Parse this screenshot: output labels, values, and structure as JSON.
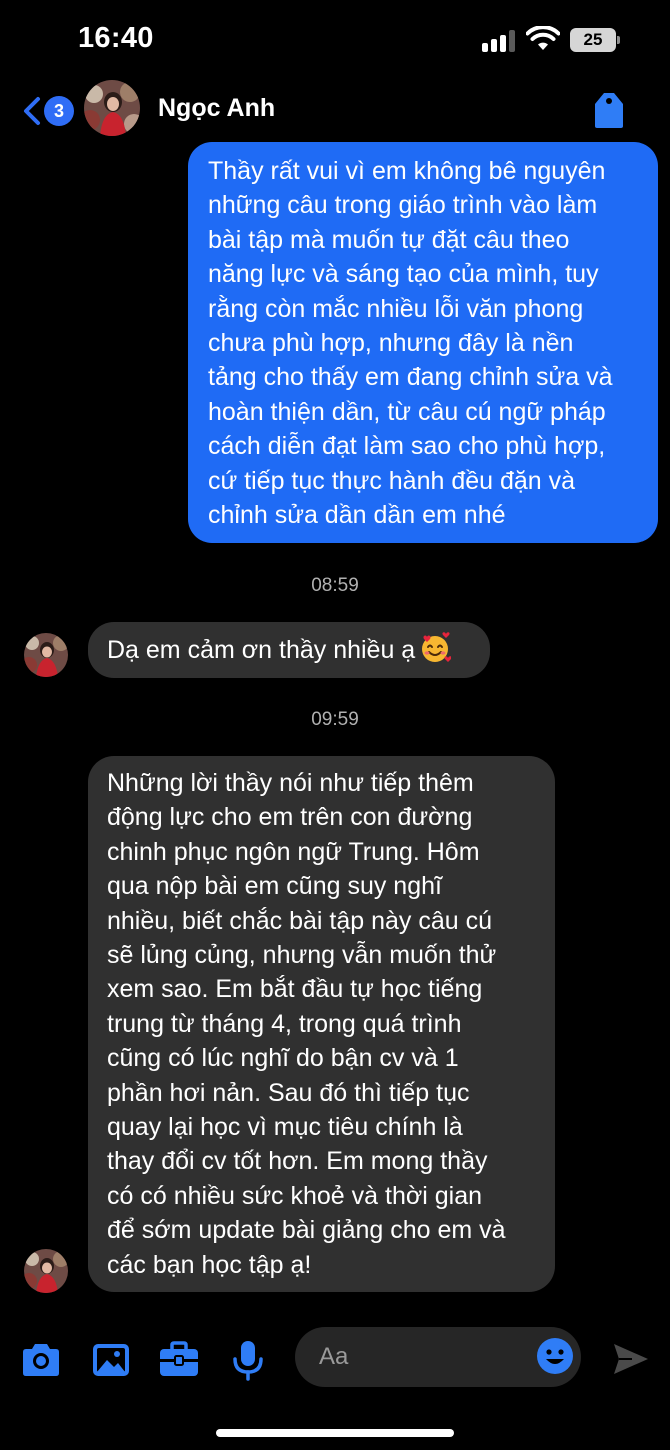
{
  "status_bar": {
    "time": "16:40",
    "battery_level": "25",
    "signal_bars": 3,
    "icons": [
      "signal-icon",
      "wifi-icon",
      "battery-icon"
    ]
  },
  "header": {
    "back_badge_count": "3",
    "contact_name": "Ngọc Anh",
    "icons": [
      "chevron-left-icon",
      "tag-icon"
    ]
  },
  "messages": {
    "outgoing_1": {
      "lines": [
        "Thầy rất vui vì em không bê nguyên",
        "những câu trong giáo trình vào làm",
        "bài tập mà muốn tự đặt câu theo",
        "năng lực và sáng tạo của mình, tuy",
        "rằng còn mắc nhiều lỗi văn phong",
        "chưa phù hợp, nhưng đây là nền",
        "tảng cho thấy em đang chỉnh sửa và",
        "hoàn thiện dần, từ câu cú ngữ pháp",
        "cách diễn đạt làm sao cho phù hợp,",
        "cứ tiếp tục thực hành đều đặn và",
        "chỉnh sửa dần dần em nhé"
      ]
    },
    "timestamp_1": "08:59",
    "incoming_1": {
      "text": "Dạ em cảm ơn thầy nhiều ạ",
      "emoji": "smiling-face-with-hearts"
    },
    "timestamp_2": "09:59",
    "incoming_2": {
      "lines": [
        "Những lời thầy nói như tiếp thêm",
        "động lực cho em trên con đường",
        "chinh phục ngôn ngữ Trung. Hôm",
        "qua nộp bài em cũng suy nghĩ",
        "nhiều, biết chắc bài tập này câu cú",
        "sẽ lủng củng, nhưng vẫn muốn thử",
        "xem sao. Em bắt đầu tự học tiếng",
        "trung từ tháng 4, trong quá trình",
        "cũng có lúc nghĩ do bận cv và 1",
        "phần hơi nản. Sau đó thì tiếp tục",
        "quay lại học vì mục tiêu chính là",
        "thay đổi cv tốt hơn. Em mong thầy",
        "có có nhiều sức khoẻ và thời gian",
        "để sớm update bài giảng cho em và",
        "các bạn học tập ạ!"
      ]
    }
  },
  "composer": {
    "placeholder": "Aa",
    "icons": [
      "camera-icon",
      "image-icon",
      "briefcase-icon",
      "microphone-icon",
      "emoji-icon",
      "send-icon"
    ]
  },
  "colors": {
    "outgoing_bubble": "#1f6bf5",
    "incoming_bubble": "#303030",
    "accent": "#2f6df6",
    "background": "#000000"
  }
}
